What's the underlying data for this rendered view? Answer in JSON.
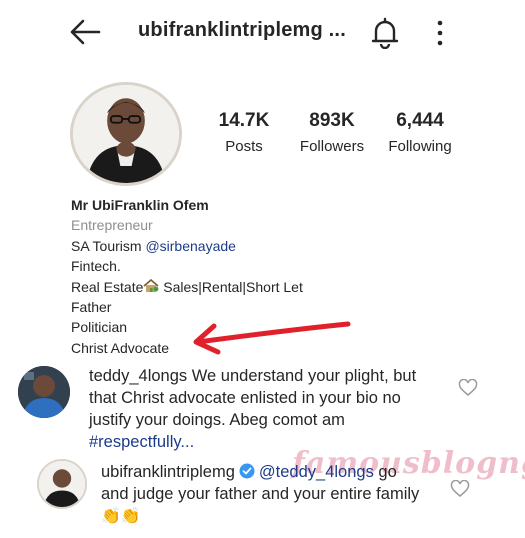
{
  "header": {
    "handle": "ubifranklintriplemg ...",
    "back_icon": "arrow-left-icon",
    "bell_icon": "bell-icon",
    "more_icon": "more-vertical-icon"
  },
  "stats": [
    {
      "value": "14.7K",
      "label": "Posts"
    },
    {
      "value": "893K",
      "label": "Followers"
    },
    {
      "value": "6,444",
      "label": "Following"
    }
  ],
  "bio": {
    "name": "Mr UbiFranklin Ofem",
    "category": "Entrepreneur",
    "line1_prefix": "SA Tourism ",
    "line1_mention": "@sirbenayade",
    "line2": "Fintech.",
    "line3_prefix": "Real Estate",
    "line3_suffix": " Sales|Rental|Short Let",
    "line4": "Father",
    "line5": "Politician",
    "line6": "Christ Advocate"
  },
  "comments": [
    {
      "username": "teddy_4longs",
      "text": " We understand your plight, but that Christ advocate enlisted in your bio no justify your doings. Abeg comot am ",
      "hashtag": "#respectfully...",
      "like_icon": "heart-outline-icon"
    },
    {
      "username": "ubifranklintriplemg",
      "mention": "@teddy_4longs",
      "text": " go and judge your father and your entire family ",
      "emoji": "👏👏",
      "like_icon": "heart-outline-icon"
    }
  ],
  "watermark": "famousblogng",
  "colors": {
    "link": "#1b3c8a",
    "muted": "#8e8e8e",
    "annotation_arrow": "#e0202a",
    "verified": "#3897f0"
  }
}
